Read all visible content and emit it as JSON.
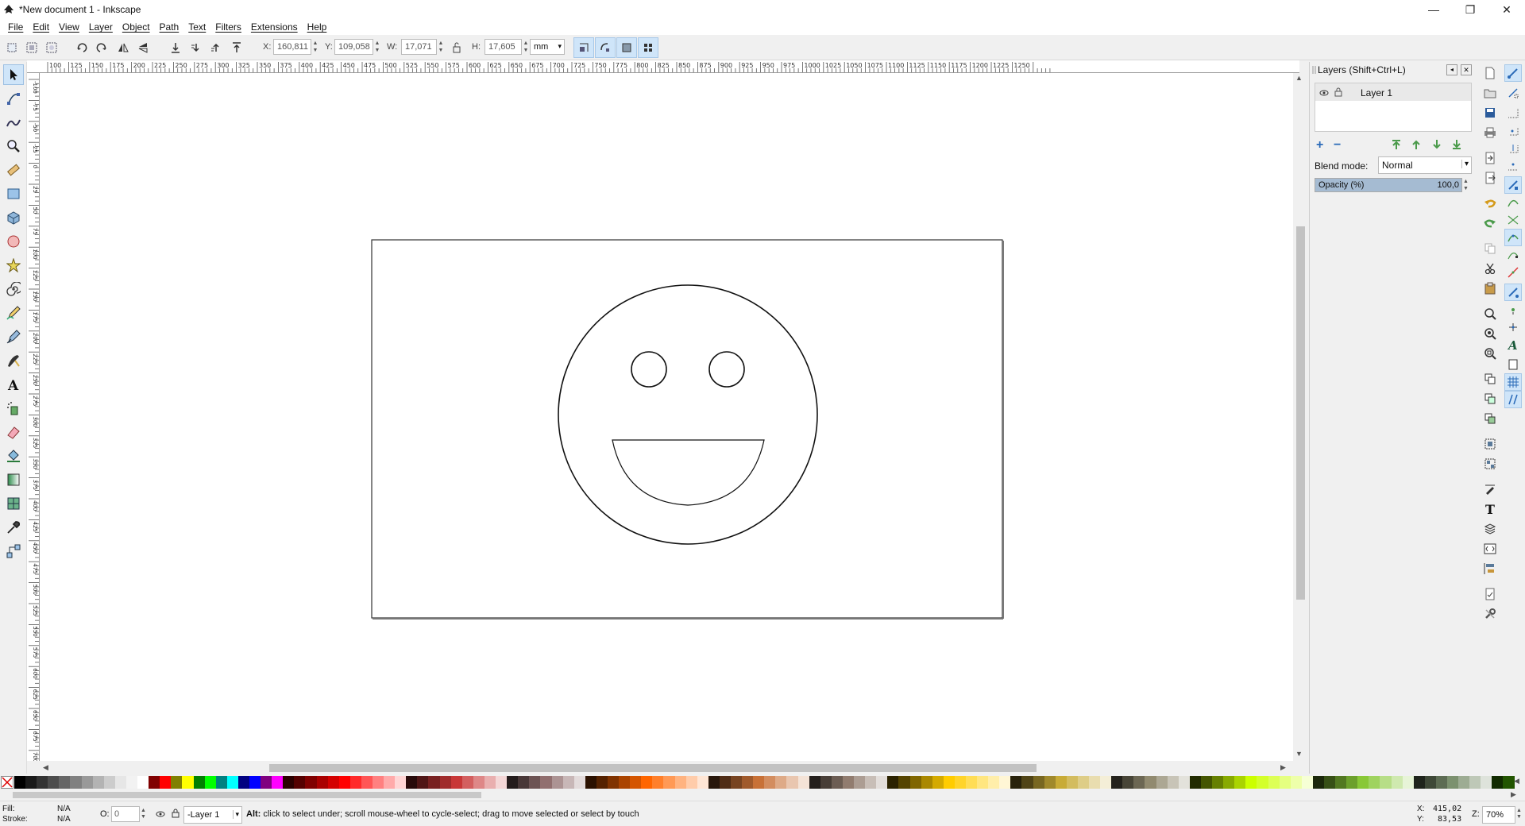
{
  "window": {
    "title": "*New document 1 - Inkscape",
    "minimize": "—",
    "maximize": "❐",
    "close": "✕"
  },
  "menu": [
    "File",
    "Edit",
    "View",
    "Layer",
    "Object",
    "Path",
    "Text",
    "Filters",
    "Extensions",
    "Help"
  ],
  "controls": {
    "x_label": "X:",
    "x_value": "160,811",
    "y_label": "Y:",
    "y_value": "109,058",
    "w_label": "W:",
    "w_value": "17,071",
    "h_label": "H:",
    "h_value": "17,605",
    "unit": "mm"
  },
  "ruler": {
    "h_labels": [
      "100",
      "125",
      "150",
      "175",
      "200",
      "225",
      "250",
      "275",
      "300",
      "325",
      "350",
      "375",
      "400",
      "425",
      "450",
      "475",
      "500",
      "525",
      "550",
      "575",
      "600",
      "625",
      "650",
      "675",
      "700",
      "725",
      "750",
      "775",
      "800",
      "825",
      "850",
      "875",
      "900",
      "925",
      "950",
      "975",
      "1000",
      "1025",
      "1050",
      "1075",
      "1100",
      "1125",
      "1150",
      "1175",
      "1200",
      "1225",
      "1250"
    ],
    "v_labels": [
      "-100",
      "-75",
      "-50",
      "-25",
      "0",
      "25",
      "50",
      "75",
      "100",
      "125",
      "150",
      "175",
      "200",
      "225",
      "250",
      "275",
      "300",
      "325",
      "350",
      "375",
      "400",
      "425",
      "450",
      "475",
      "500",
      "525",
      "550",
      "575",
      "600",
      "625",
      "650",
      "675",
      "700"
    ]
  },
  "layers_panel": {
    "title": "Layers (Shift+Ctrl+L)",
    "layer_name": "Layer 1",
    "blend_label": "Blend mode:",
    "blend_value": "Normal",
    "opacity_label": "Opacity (%)",
    "opacity_value": "100,0",
    "opacity_fraction": 1.0
  },
  "status": {
    "fill_label": "Fill:",
    "fill_value": "N/A",
    "stroke_label": "Stroke:",
    "stroke_value": "N/A",
    "o_label": "O:",
    "o_value": "0",
    "layer_select": "-Layer 1",
    "message_bold": "Alt:",
    "message": " click to select under; scroll mouse-wheel to cycle-select; drag to move selected or select by touch",
    "x_coord_label": "X:",
    "x_coord": "415,02",
    "y_coord_label": "Y:",
    "y_coord": "83,53",
    "zoom_label": "Z:",
    "zoom_value": "70%"
  },
  "colors": {
    "accent": "#cfe5f9",
    "palette": [
      "#000000",
      "#1a1a1a",
      "#333333",
      "#4d4d4d",
      "#666666",
      "#808080",
      "#999999",
      "#b3b3b3",
      "#cccccc",
      "#e6e6e6",
      "#f2f2f2",
      "#ffffff",
      "#800000",
      "#ff0000",
      "#808000",
      "#ffff00",
      "#008000",
      "#00ff00",
      "#008080",
      "#00ffff",
      "#000080",
      "#0000ff",
      "#800080",
      "#ff00ff",
      "#2b0000",
      "#550000",
      "#800000",
      "#aa0000",
      "#d40000",
      "#ff0000",
      "#ff2a2a",
      "#ff5555",
      "#ff8080",
      "#ffaaaa",
      "#ffd5d5",
      "#280b0b",
      "#501616",
      "#782121",
      "#a02c2c",
      "#c83737",
      "#d35f5f",
      "#de8787",
      "#e9afaf",
      "#f4d7d7",
      "#241c1c",
      "#483737",
      "#6c5353",
      "#916f6f",
      "#ac9393",
      "#c8b7b7",
      "#e3dbdb",
      "#2b1100",
      "#552200",
      "#803300",
      "#aa4400",
      "#d45500",
      "#ff6600",
      "#ff7f2a",
      "#ff9955",
      "#ffb380",
      "#ffccaa",
      "#ffe6d5",
      "#28170b",
      "#502d16",
      "#784421",
      "#a05a2c",
      "#c87137",
      "#d38d5f",
      "#deaa87",
      "#e9c6af",
      "#f4e3d7",
      "#241f1c",
      "#483e37",
      "#6c5d53",
      "#917c6f",
      "#ac9d93",
      "#c8beb7",
      "#e3dedb",
      "#2b2200",
      "#554400",
      "#806600",
      "#aa8800",
      "#d4aa00",
      "#ffcc00",
      "#ffd42a",
      "#ffdd55",
      "#ffe680",
      "#ffeeaa",
      "#fff6d5",
      "#28220b",
      "#504416",
      "#786721",
      "#a0892c",
      "#c8ab37",
      "#d3bc5f",
      "#decd87",
      "#e9ddaf",
      "#f4eed7",
      "#24221c",
      "#484537",
      "#6c6753",
      "#918a6f",
      "#aca793",
      "#c8c4b7",
      "#e3e2db",
      "#222b00",
      "#445500",
      "#668000",
      "#88aa00",
      "#aad400",
      "#ccff00",
      "#d4ff2a",
      "#ddff55",
      "#e5ff80",
      "#eeffaa",
      "#f6ffd5",
      "#1c280b",
      "#375016",
      "#527821",
      "#6ca02c",
      "#89c837",
      "#9fd35f",
      "#b7de87",
      "#cfe9af",
      "#e7f4d7",
      "#1f241c",
      "#3e4837",
      "#5d6c53",
      "#7c916f",
      "#9dac93",
      "#bec8b7",
      "#dee3db",
      "#112b00",
      "#225500"
    ]
  }
}
